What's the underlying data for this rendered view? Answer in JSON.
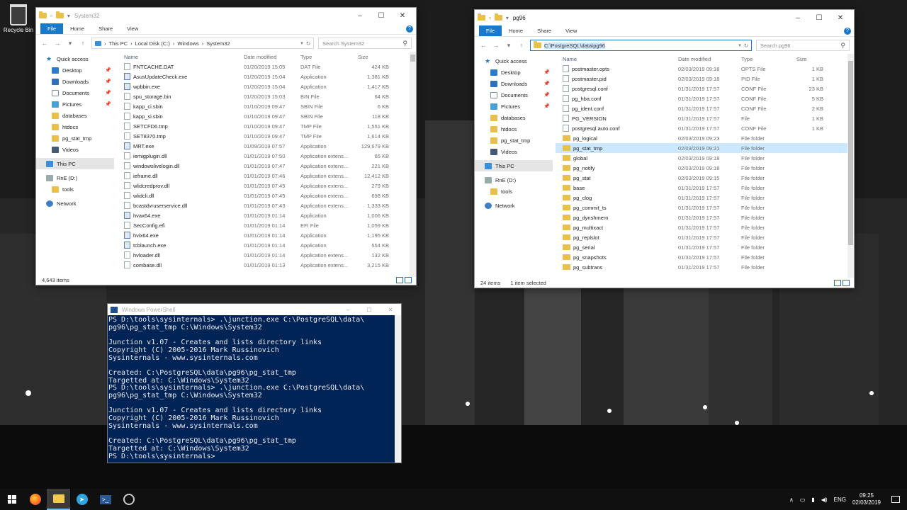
{
  "desktop": {
    "recycle_bin": "Recycle Bin"
  },
  "win1": {
    "title": "System32",
    "ribbon": [
      "File",
      "Home",
      "Share",
      "View"
    ],
    "breadcrumb": [
      "This PC",
      "Local Disk (C:)",
      "Windows",
      "System32"
    ],
    "search_placeholder": "Search System32",
    "nav": [
      {
        "label": "Quick access",
        "icon": "star-icon"
      },
      {
        "label": "Desktop",
        "icon": "desktop-icon",
        "pinned": true
      },
      {
        "label": "Downloads",
        "icon": "downloads-icon",
        "pinned": true
      },
      {
        "label": "Documents",
        "icon": "documents-icon",
        "pinned": true
      },
      {
        "label": "Pictures",
        "icon": "pictures-icon",
        "pinned": true
      },
      {
        "label": "databases",
        "icon": "folder-icon"
      },
      {
        "label": "htdocs",
        "icon": "folder-icon"
      },
      {
        "label": "pg_stat_tmp",
        "icon": "folder-icon"
      },
      {
        "label": "Videos",
        "icon": "videos-icon"
      },
      {
        "label": "This PC",
        "icon": "pc-icon"
      },
      {
        "label": "RnE (D:)",
        "icon": "drive-icon"
      },
      {
        "label": "tools",
        "icon": "folder-icon"
      },
      {
        "label": "Network",
        "icon": "network-icon"
      }
    ],
    "columns": [
      "Name",
      "Date modified",
      "Type",
      "Size"
    ],
    "files": [
      [
        "FNTCACHE.DAT",
        "01/20/2019 15:05",
        "DAT File",
        "424 KB"
      ],
      [
        "AsusUpdateCheck.exe",
        "01/20/2019 15:04",
        "Application",
        "1,381 KB"
      ],
      [
        "wpbbin.exe",
        "01/20/2019 15:04",
        "Application",
        "1,417 KB"
      ],
      [
        "spu_storage.bin",
        "01/20/2019 15:03",
        "BIN File",
        "64 KB"
      ],
      [
        "kapp_ci.sbin",
        "01/10/2019 09:47",
        "SBIN File",
        "6 KB"
      ],
      [
        "kapp_si.sbin",
        "01/10/2019 09:47",
        "SBIN File",
        "118 KB"
      ],
      [
        "SETCFD6.tmp",
        "01/10/2019 09:47",
        "TMP File",
        "1,551 KB"
      ],
      [
        "SET8370.tmp",
        "01/10/2019 09:47",
        "TMP File",
        "1,614 KB"
      ],
      [
        "MRT.exe",
        "01/09/2019 07:57",
        "Application",
        "129,679 KB"
      ],
      [
        "iemigplugin.dll",
        "01/01/2019 07:50",
        "Application extens...",
        "65 KB"
      ],
      [
        "windowslivelogin.dll",
        "01/01/2019 07:47",
        "Application extens...",
        "221 KB"
      ],
      [
        "ieframe.dll",
        "01/01/2019 07:46",
        "Application extens...",
        "12,412 KB"
      ],
      [
        "wlidcredprov.dll",
        "01/01/2019 07:45",
        "Application extens...",
        "279 KB"
      ],
      [
        "wlidcli.dll",
        "01/01/2019 07:45",
        "Application extens...",
        "698 KB"
      ],
      [
        "bcastdvruserservice.dll",
        "01/01/2019 07:43",
        "Application extens...",
        "1,333 KB"
      ],
      [
        "hvax64.exe",
        "01/01/2019 01:14",
        "Application",
        "1,006 KB"
      ],
      [
        "SecConfig.efi",
        "01/01/2019 01:14",
        "EFI File",
        "1,059 KB"
      ],
      [
        "hvix64.exe",
        "01/01/2019 01:14",
        "Application",
        "1,195 KB"
      ],
      [
        "tcblaunch.exe",
        "01/01/2019 01:14",
        "Application",
        "554 KB"
      ],
      [
        "hvloader.dll",
        "01/01/2019 01:14",
        "Application extens...",
        "132 KB"
      ],
      [
        "combase.dll",
        "01/01/2019 01:13",
        "Application extens...",
        "3,215 KB"
      ]
    ],
    "status_items": "4,643 items"
  },
  "win2": {
    "title": "pg96",
    "ribbon": [
      "File",
      "Home",
      "Share",
      "View"
    ],
    "address": "C:\\PostgreSQL\\data\\pg96",
    "search_placeholder": "Search pg96",
    "nav": [
      {
        "label": "Quick access",
        "icon": "star-icon"
      },
      {
        "label": "Desktop",
        "icon": "desktop-icon",
        "pinned": true
      },
      {
        "label": "Downloads",
        "icon": "downloads-icon",
        "pinned": true
      },
      {
        "label": "Documents",
        "icon": "documents-icon",
        "pinned": true
      },
      {
        "label": "Pictures",
        "icon": "pictures-icon",
        "pinned": true
      },
      {
        "label": "databases",
        "icon": "folder-icon"
      },
      {
        "label": "htdocs",
        "icon": "folder-icon"
      },
      {
        "label": "pg_stat_tmp",
        "icon": "folder-icon"
      },
      {
        "label": "Videos",
        "icon": "videos-icon"
      },
      {
        "label": "This PC",
        "icon": "pc-icon"
      },
      {
        "label": "RnE (D:)",
        "icon": "drive-icon"
      },
      {
        "label": "tools",
        "icon": "folder-icon"
      },
      {
        "label": "Network",
        "icon": "network-icon"
      }
    ],
    "columns": [
      "Name",
      "Date modified",
      "Type",
      "Size"
    ],
    "files": [
      [
        "postmaster.opts",
        "02/03/2019 09:18",
        "OPTS File",
        "1 KB",
        "file"
      ],
      [
        "postmaster.pid",
        "02/03/2019 09:18",
        "PID File",
        "1 KB",
        "file"
      ],
      [
        "postgresql.conf",
        "01/31/2019 17:57",
        "CONF File",
        "23 KB",
        "file"
      ],
      [
        "pg_hba.conf",
        "01/31/2019 17:57",
        "CONF File",
        "5 KB",
        "file"
      ],
      [
        "pg_ident.conf",
        "01/31/2019 17:57",
        "CONF File",
        "2 KB",
        "file"
      ],
      [
        "PG_VERSION",
        "01/31/2019 17:57",
        "File",
        "1 KB",
        "file"
      ],
      [
        "postgresql.auto.conf",
        "01/31/2019 17:57",
        "CONF File",
        "1 KB",
        "file"
      ],
      [
        "pg_logical",
        "02/03/2019 09:23",
        "File folder",
        "",
        "folder"
      ],
      [
        "pg_stat_tmp",
        "02/03/2019 09:21",
        "File folder",
        "",
        "folder"
      ],
      [
        "global",
        "02/03/2019 09:18",
        "File folder",
        "",
        "folder"
      ],
      [
        "pg_notify",
        "02/03/2019 09:18",
        "File folder",
        "",
        "folder"
      ],
      [
        "pg_stat",
        "02/03/2019 09:15",
        "File folder",
        "",
        "folder"
      ],
      [
        "base",
        "01/31/2019 17:57",
        "File folder",
        "",
        "folder"
      ],
      [
        "pg_clog",
        "01/31/2019 17:57",
        "File folder",
        "",
        "folder"
      ],
      [
        "pg_commit_ts",
        "01/31/2019 17:57",
        "File folder",
        "",
        "folder"
      ],
      [
        "pg_dynshmem",
        "01/31/2019 17:57",
        "File folder",
        "",
        "folder"
      ],
      [
        "pg_multixact",
        "01/31/2019 17:57",
        "File folder",
        "",
        "folder"
      ],
      [
        "pg_replslot",
        "01/31/2019 17:57",
        "File folder",
        "",
        "folder"
      ],
      [
        "pg_serial",
        "01/31/2019 17:57",
        "File folder",
        "",
        "folder"
      ],
      [
        "pg_snapshots",
        "01/31/2019 17:57",
        "File folder",
        "",
        "folder"
      ],
      [
        "pg_subtrans",
        "01/31/2019 17:57",
        "File folder",
        "",
        "folder"
      ]
    ],
    "selected_file": "pg_stat_tmp",
    "status_items": "24 items",
    "status_selected": "1 item selected"
  },
  "powershell": {
    "title": "Windows PowerShell",
    "text": "PS D:\\tools\\sysinternals> .\\junction.exe C:\\PostgreSQL\\data\\\npg96\\pg_stat_tmp C:\\Windows\\System32\n\nJunction v1.07 - Creates and lists directory links\nCopyright (C) 2005-2016 Mark Russinovich\nSysinternals - www.sysinternals.com\n\nCreated: C:\\PostgreSQL\\data\\pg96\\pg_stat_tmp\nTargetted at: C:\\Windows\\System32\nPS D:\\tools\\sysinternals> .\\junction.exe C:\\PostgreSQL\\data\\\npg96\\pg_stat_tmp C:\\Windows\\System32\n\nJunction v1.07 - Creates and lists directory links\nCopyright (C) 2005-2016 Mark Russinovich\nSysinternals - www.sysinternals.com\n\nCreated: C:\\PostgreSQL\\data\\pg96\\pg_stat_tmp\nTargetted at: C:\\Windows\\System32\nPS D:\\tools\\sysinternals>"
  },
  "taskbar": {
    "apps": [
      "start-icon",
      "firefox-icon",
      "explorer-icon",
      "telegram-icon",
      "powershell-icon",
      "settings-icon"
    ],
    "lang": "ENG",
    "time": "09:25",
    "date": "02/03/2019"
  },
  "colors": {
    "accent": "#1979ca",
    "ps_bg": "#012456",
    "selection": "#cce8ff"
  }
}
